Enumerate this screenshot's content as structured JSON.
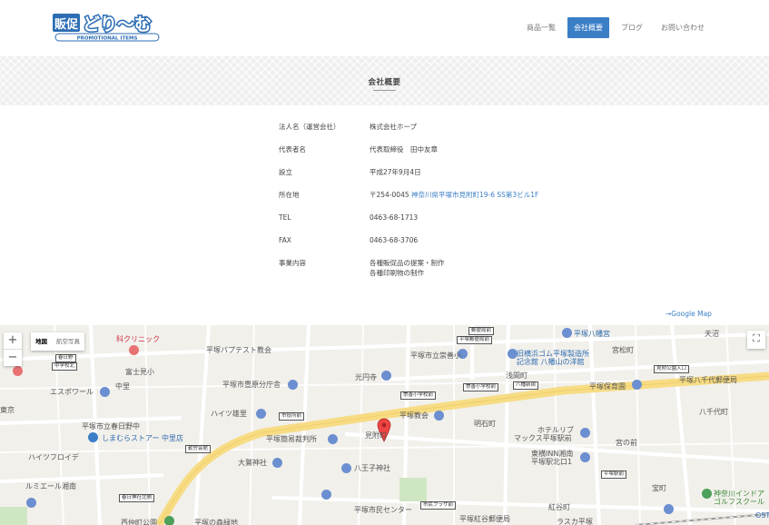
{
  "header": {
    "logo_text_ja": "販促どり〜む",
    "logo_text_en": "PROMOTIONAL ITEMS",
    "nav": [
      {
        "label": "商品一覧",
        "active": false
      },
      {
        "label": "会社概要",
        "active": true
      },
      {
        "label": "ブログ",
        "active": false
      },
      {
        "label": "お問い合わせ",
        "active": false
      }
    ]
  },
  "banner": {
    "title": "会社概要"
  },
  "company": {
    "rows": [
      {
        "key": "法人名（運営会社）",
        "value": "株式会社ホープ",
        "link": true
      },
      {
        "key": "代表者名",
        "value": "代表取締役　田中友章",
        "link": false
      },
      {
        "key": "設立",
        "value": "平成27年9月4日",
        "link": false
      },
      {
        "key": "所在地",
        "value_prefix": "〒254-0045 ",
        "value": "神奈川県平塚市見附町19-6 SS第3ビル1F",
        "link": true
      },
      {
        "key": "TEL",
        "value": "0463-68-1713",
        "link": true
      },
      {
        "key": "FAX",
        "value": "0463-68-3706",
        "link": false
      },
      {
        "key": "事業内容",
        "value": "各種販促品の提案・制作",
        "value2": "各種印刷物の制作",
        "link": false
      }
    ],
    "gmap_link": "→Google Map"
  },
  "map": {
    "controls": {
      "zoom_in": "+",
      "zoom_out": "−",
      "type_map": "地図",
      "type_satellite": "航空写真",
      "fullscreen": "⛶"
    },
    "labels": {
      "hospital": "科クリニック",
      "hachimangu": "平塚八幡宮",
      "tennuma": "天沼",
      "baptist": "平塚バプテスト教会",
      "sogaoka": "平塚市立崇善小",
      "yokohama_rubber": "旧横浜ゴム平塚製造所",
      "kinenkan": "記念館 八幡山の洋館",
      "miyamachi": "宮松町",
      "fujimi": "富士見小",
      "kotobuki": "平塚市豊原分庁舎",
      "koenji": "光円寺",
      "asamacho": "浅間町",
      "hodoen": "平塚保育園",
      "hachisenyo": "平塚八千代郵便局",
      "espoir": "エスポワール",
      "naka": "中里",
      "haimu": "ハイツ雄里",
      "kyokai": "平塚教会",
      "meiseki": "明石町",
      "hachisendai": "八千代町",
      "kasuganomachi": "平塚市立春日野中",
      "shimamura": "しまむらストアー 中里店",
      "hotel": "ホテルリブ",
      "hotel2": "マックス平塚駅前",
      "heiwa": "平塚簡易裁判所",
      "mitsuke": "見附町",
      "toyoko": "東横INN湘南",
      "toyoko2": "平塚駅北口1",
      "miyanomae": "宮の前",
      "haitsu": "ハイツフロイデ",
      "oyashiro": "大鷲神社",
      "hachioji": "八王子神社",
      "takara": "宝町",
      "lumiere": "ルミエール湘南",
      "civic": "平塚市民センター",
      "kogai": "平塚紅谷郵便局",
      "beniya": "紅谷町",
      "golf": "神奈川インドア",
      "golf2": "ゴルフスクール",
      "nishi": "西仲町公園",
      "tenko": "平塚の森緑地",
      "lasca": "ラスカ平塚",
      "kasuga": "春日野",
      "chugakko": "中学校北",
      "dojo": "東京",
      "ost": "OST"
    },
    "signs": [
      "郵便局前",
      "平塚郵便局前",
      "春日野",
      "中学校北",
      "崇善小学校前",
      "崇善小学校前",
      "八幡新宿",
      "見附公園入口",
      "市役所前",
      "勤労会館",
      "平塚駅前",
      "市民プラザ前",
      "春日神社北側"
    ]
  }
}
